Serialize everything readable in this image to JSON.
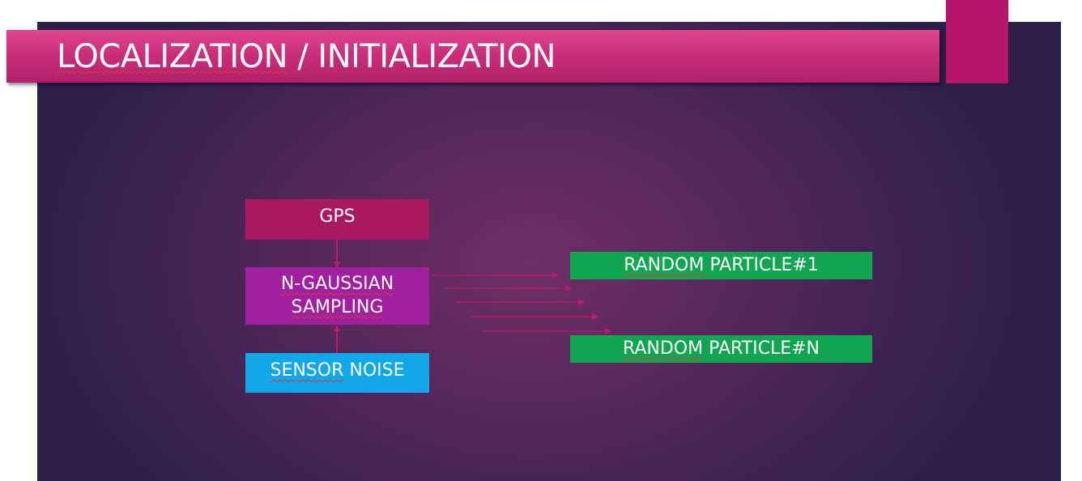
{
  "slide": {
    "title_word1": "LOCALIZATION",
    "title_rest": " / INITIALIZATION"
  },
  "diagram": {
    "gps": "GPS",
    "sampling_line1": "N-GAUSSIAN",
    "sampling_line2": "SAMPLING",
    "noise_word1": "SENSOR",
    "noise_rest": " NOISE",
    "particle_first_word1": "RANDOM",
    "particle_first_rest": " PARTICLE#1",
    "particle_last_word1": "RANDOM",
    "particle_last_rest": " PARTICLE#N"
  },
  "colors": {
    "title_bar": "#c92d7a",
    "gps_box": "#a8195f",
    "sampling_box": "#a020a0",
    "noise_box": "#10a8e8",
    "particle_box": "#10a650",
    "connector": "#c2186b"
  }
}
